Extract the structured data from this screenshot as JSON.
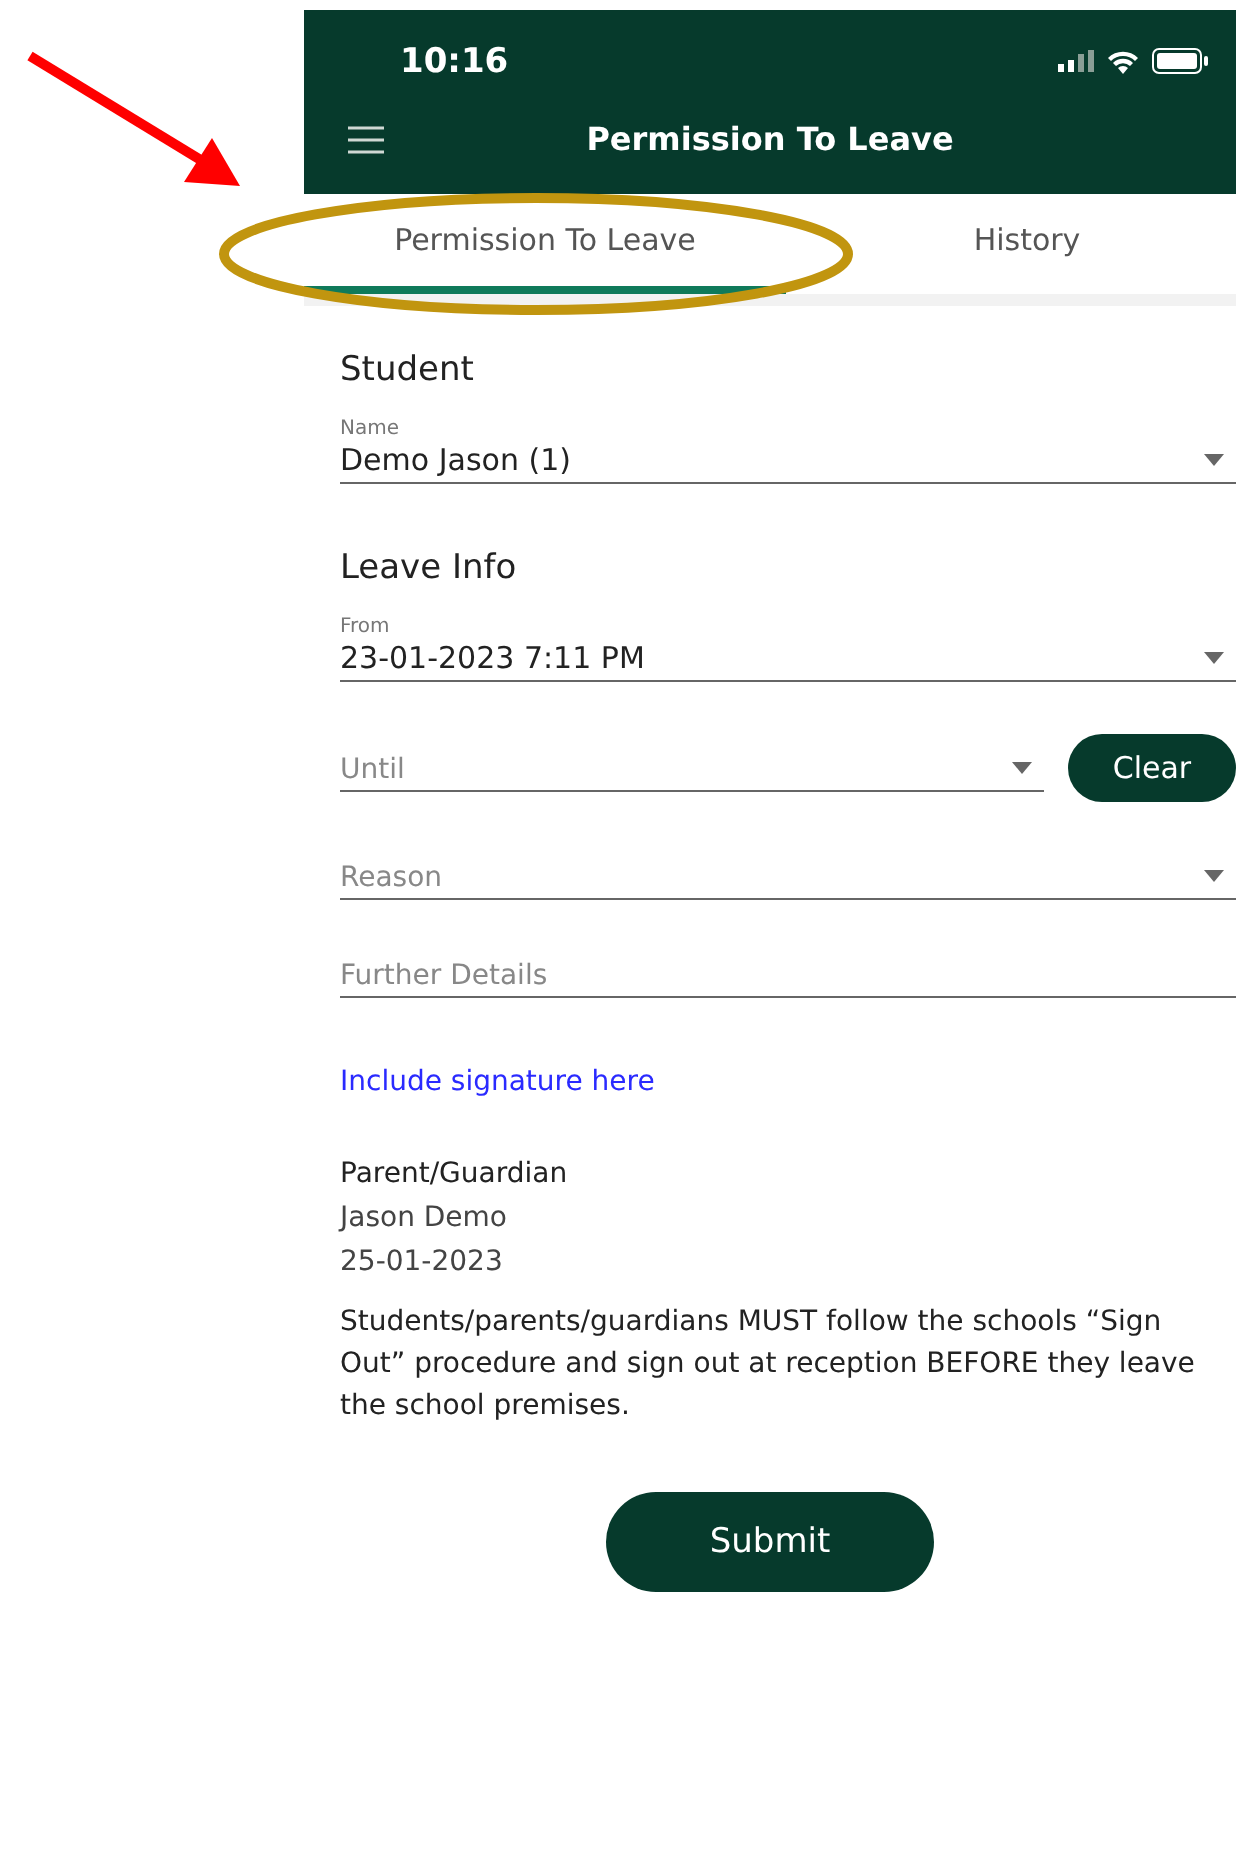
{
  "status_bar": {
    "time": "10:16"
  },
  "header": {
    "title": "Permission To Leave"
  },
  "tabs": [
    {
      "label": "Permission To Leave",
      "selected": true
    },
    {
      "label": "History",
      "selected": false
    }
  ],
  "student": {
    "heading": "Student",
    "fields": [
      {
        "kind": "select",
        "label": "Name",
        "value": "Demo Jason (1)"
      }
    ]
  },
  "leave_info": {
    "heading": "Leave Info",
    "fields": [
      {
        "kind": "select",
        "label": "From",
        "value": "23-01-2023  7:11 PM"
      },
      {
        "kind": "select_clear",
        "placeholder": "Until",
        "button": "Clear"
      },
      {
        "kind": "select",
        "placeholder": "Reason"
      },
      {
        "kind": "text",
        "placeholder": "Further Details"
      }
    ]
  },
  "signature_link": "Include signature here",
  "parent": {
    "heading": "Parent/Guardian",
    "name": "Jason Demo",
    "date": "25-01-2023"
  },
  "notice": "Students/parents/guardians MUST follow the schools “Sign Out” procedure and sign out at reception BEFORE they leave the school premises.",
  "submit": "Submit"
}
